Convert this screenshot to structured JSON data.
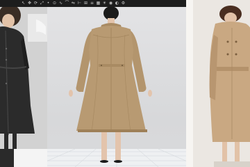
{
  "toolbar": {
    "tools": [
      {
        "icon": "select-arrow-icon",
        "glyph": "↖"
      },
      {
        "icon": "move-icon",
        "glyph": "✥"
      },
      {
        "icon": "rotate-icon",
        "glyph": "⟳"
      },
      {
        "icon": "scale-icon",
        "glyph": "⤢"
      },
      {
        "icon": "point-icon",
        "glyph": "•"
      },
      {
        "icon": "pin-icon",
        "glyph": "⊙"
      },
      {
        "icon": "sew-icon",
        "glyph": "∿"
      },
      {
        "icon": "fold-icon",
        "glyph": "⌒"
      },
      {
        "icon": "mirror-icon",
        "glyph": "⇋"
      },
      {
        "icon": "measure-icon",
        "glyph": "⊢"
      },
      {
        "icon": "grid-icon",
        "glyph": "⊞"
      },
      {
        "icon": "layer-icon",
        "glyph": "≡"
      },
      {
        "icon": "texture-icon",
        "glyph": "▦"
      },
      {
        "icon": "light-icon",
        "glyph": "☀"
      },
      {
        "icon": "camera-icon",
        "glyph": "◉"
      },
      {
        "icon": "view-icon",
        "glyph": "◐"
      },
      {
        "icon": "settings-icon",
        "glyph": "⚙"
      }
    ]
  },
  "colors": {
    "coat": "#b89a72",
    "coat_shadow": "#9e8058",
    "coat_highlight": "#c9ad86",
    "skin": "#e3c4ac",
    "hair": "#1a1a1a",
    "leather": "#2b2b2b",
    "right_coat": "#c9a882",
    "toolbar": "#1d1d1d"
  }
}
